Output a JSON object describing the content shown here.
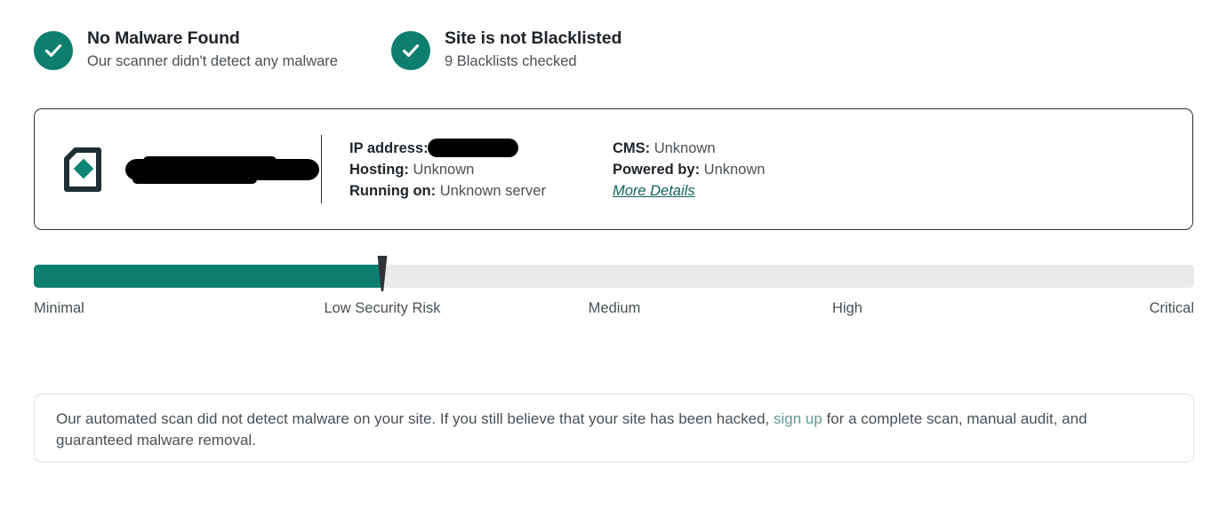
{
  "statuses": [
    {
      "icon": "check-circle-icon",
      "title": "No Malware Found",
      "subtitle": "Our scanner didn't detect any malware"
    },
    {
      "icon": "check-circle-icon",
      "title": "Site is not Blacklisted",
      "subtitle": "9 Blacklists checked"
    }
  ],
  "site_card": {
    "logo_icon": "site-document-diamond-icon",
    "site_name": "",
    "site_name_redacted": true,
    "details": {
      "left": [
        {
          "label": "IP address:",
          "value": "",
          "redacted": true
        },
        {
          "label": "Hosting:",
          "value": "Unknown",
          "redacted": false
        },
        {
          "label": "Running on:",
          "value": "Unknown server",
          "redacted": false
        }
      ],
      "right": [
        {
          "label": "CMS:",
          "value": "Unknown",
          "redacted": false
        },
        {
          "label": "Powered by:",
          "value": "Unknown",
          "redacted": false
        }
      ],
      "more_details_label": "More Details"
    }
  },
  "risk_meter": {
    "fill_percent": 30,
    "marker_percent": 30,
    "fill_color": "#0d7f6f",
    "track_color": "#eaeaea",
    "marker_color": "#2f3337",
    "current_level": "Low Security Risk",
    "labels": [
      "Minimal",
      "Low Security Risk",
      "Medium",
      "High",
      "Critical"
    ]
  },
  "notice": {
    "text_before_link": "Our automated scan did not detect malware on your site. If you still believe that your site has been hacked, ",
    "link_label": "sign up",
    "text_after_link": " for a complete scan, manual audit, and guaranteed malware removal."
  },
  "colors": {
    "accent_teal": "#0d7f6f",
    "link_teal": "#5e9c8f",
    "more_details_teal": "#0d6459",
    "text": "#4a5055",
    "heading": "#1f2429"
  }
}
